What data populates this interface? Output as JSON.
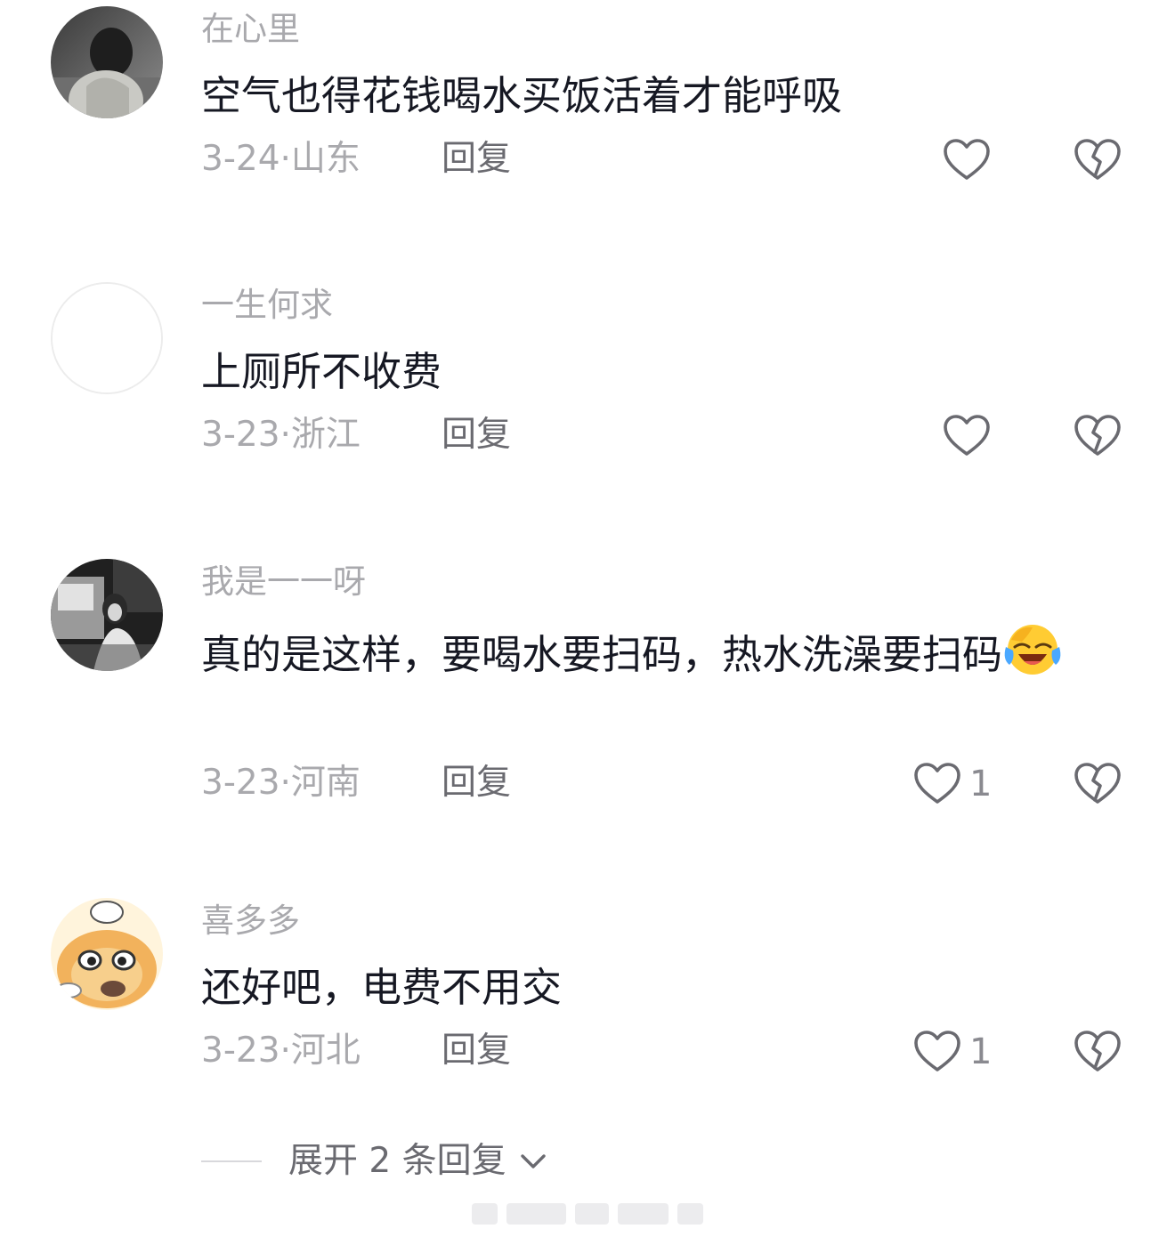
{
  "comments": [
    {
      "username": "在心里",
      "text": "空气也得花钱喝水买饭活着才能呼吸",
      "date": "3-24",
      "separator": "·",
      "location": "山东",
      "reply_label": "回复",
      "like_count": "",
      "avatar_icon": "profile-photo-icon"
    },
    {
      "username": "一生何求",
      "text": "上厕所不收费",
      "date": "3-23",
      "separator": "·",
      "location": "浙江",
      "reply_label": "回复",
      "like_count": "",
      "avatar_icon": "blank-avatar-icon"
    },
    {
      "username": "我是一一呀",
      "text": "真的是这样，要喝水要扫码，热水洗澡要扫码",
      "emoji": "tears-of-joy-emoji-icon",
      "date": "3-23",
      "separator": "·",
      "location": "河南",
      "reply_label": "回复",
      "like_count": "1",
      "avatar_icon": "profile-photo-icon"
    },
    {
      "username": "喜多多",
      "text": "还好吧，电费不用交",
      "date": "3-23",
      "separator": "·",
      "location": "河北",
      "reply_label": "回复",
      "like_count": "1",
      "avatar_icon": "cartoon-chef-avatar-icon"
    }
  ],
  "expand": {
    "label": "展开 2 条回复",
    "icon": "chevron-down-icon"
  },
  "icons": {
    "like": "heart-outline-icon",
    "dislike": "broken-heart-icon"
  },
  "colors": {
    "text": "#161823",
    "muted": "#a9a9ad",
    "secondary": "#6a6a70",
    "background": "#ffffff"
  }
}
